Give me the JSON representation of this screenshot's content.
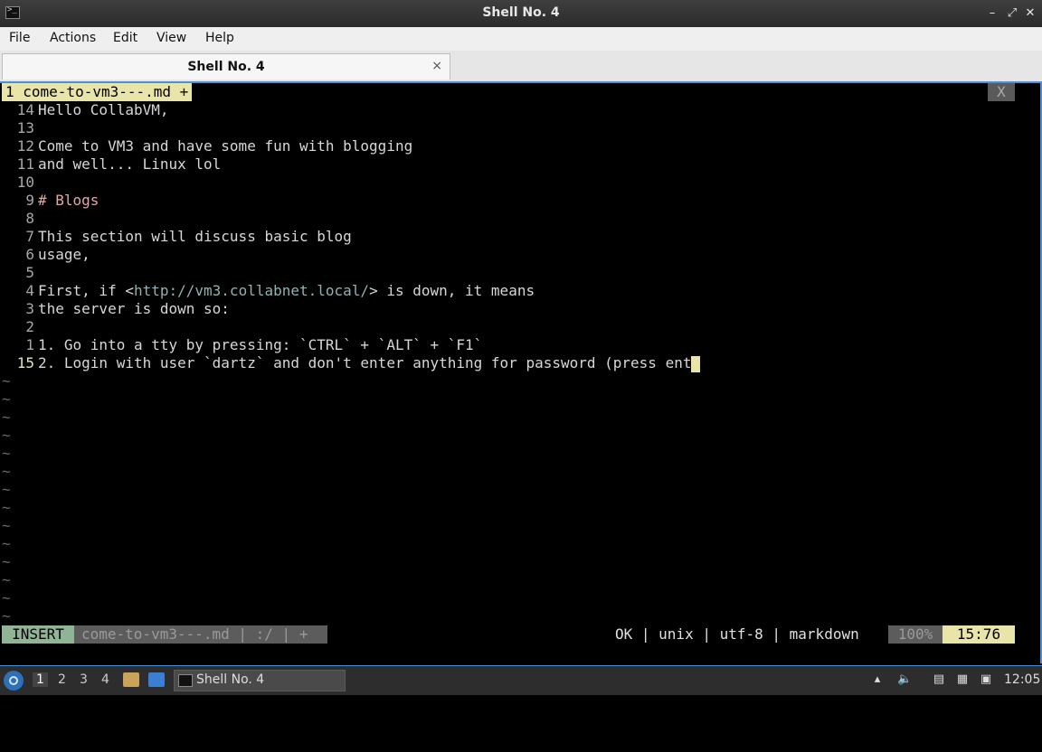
{
  "window": {
    "title": "Shell No. 4"
  },
  "menu": [
    "File",
    "Actions",
    "Edit",
    "View",
    "Help"
  ],
  "tab": {
    "label": "Shell No. 4",
    "close": "×"
  },
  "editor": {
    "buffer_tab": "1 come-to-vm3---.md +",
    "close_label": "X",
    "lines": [
      {
        "num": "14",
        "text": "Hello CollabVM,"
      },
      {
        "num": "13",
        "text": ""
      },
      {
        "num": "12",
        "text": "Come to VM3 and have some fun with blogging"
      },
      {
        "num": "11",
        "text": "and well... Linux lol"
      },
      {
        "num": "10",
        "text": ""
      },
      {
        "num": "9",
        "text": "# Blogs"
      },
      {
        "num": "8",
        "text": ""
      },
      {
        "num": "7",
        "text": "This section will discuss basic blog"
      },
      {
        "num": "6",
        "text": "usage,"
      },
      {
        "num": "5",
        "text": ""
      },
      {
        "num": "4",
        "pre": "First, if <",
        "url": "http://vm3.collabnet.local/",
        "post": "> is down, it means"
      },
      {
        "num": "3",
        "text": "the server is down so:"
      },
      {
        "num": "2",
        "text": ""
      },
      {
        "num": "1",
        "text": "1. Go into a tty by pressing: `CTRL` + `ALT` + `F1`"
      },
      {
        "num": "15",
        "text": "2. Login with user `dartz` and don't enter anything for password (press ent"
      }
    ],
    "tilde_count": 14,
    "status": {
      "mode": "INSERT",
      "file": "come-to-vm3---.md | :/ | +",
      "info": "OK | unix | utf-8 | markdown",
      "percent": "100%",
      "position": "15:76"
    }
  },
  "taskbar": {
    "workspaces": [
      "1",
      "2",
      "3",
      "4"
    ],
    "task_label": "Shell No. 4",
    "clock": "12:05"
  }
}
